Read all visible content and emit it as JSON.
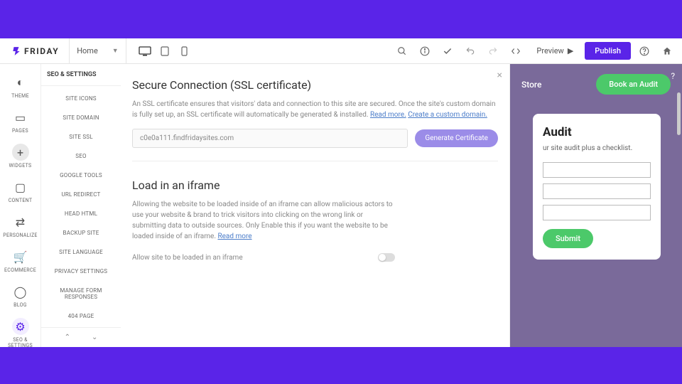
{
  "logo": {
    "text": "FRIDAY"
  },
  "topbar": {
    "page": "Home",
    "preview": "Preview",
    "publish": "Publish"
  },
  "rail": [
    {
      "label": "THEME",
      "icon": "palette"
    },
    {
      "label": "PAGES",
      "icon": "pages"
    },
    {
      "label": "WIDGETS",
      "icon": "plus"
    },
    {
      "label": "CONTENT",
      "icon": "folder"
    },
    {
      "label": "PERSONALIZE",
      "icon": "sliders"
    },
    {
      "label": "ECOMMERCE",
      "icon": "cart"
    },
    {
      "label": "BLOG",
      "icon": "chat"
    },
    {
      "label": "SEO & SETTINGS",
      "icon": "gear"
    }
  ],
  "panel": {
    "title": "SEO & SETTINGS",
    "items": [
      "SITE ICONS",
      "SITE DOMAIN",
      "SITE SSL",
      "SEO",
      "GOOGLE TOOLS",
      "URL REDIRECT",
      "HEAD HTML",
      "BACKUP SITE",
      "SITE LANGUAGE",
      "PRIVACY SETTINGS",
      "MANAGE FORM RESPONSES",
      "404 PAGE"
    ]
  },
  "ssl": {
    "title": "Secure Connection (SSL certificate)",
    "desc": "An SSL certificate ensures that visitors' data and connection to this site are secured. Once the site's custom domain is fully set up, an SSL certificate will automatically be generated & installed. ",
    "read_more": "Read more.",
    "create_domain": "Create a custom domain.",
    "domain": "c0e0a111.findfridaysites.com",
    "button": "Generate Certificate"
  },
  "iframe": {
    "title": "Load in an iframe",
    "desc": "Allowing the website to be loaded inside of an iframe can allow malicious actors to use your website & brand to trick visitors into clicking on the wrong link or submitting data to outside sources. Only Enable this if you want the website to be loaded inside of an iframe. ",
    "read_more": "Read more",
    "toggle_label": "Allow site to be loaded in an iframe"
  },
  "preview": {
    "store": "Store",
    "audit_btn": "Book an Audit",
    "card_title": "Audit",
    "card_desc": "ur site audit plus a checklist.",
    "submit": "Submit"
  }
}
